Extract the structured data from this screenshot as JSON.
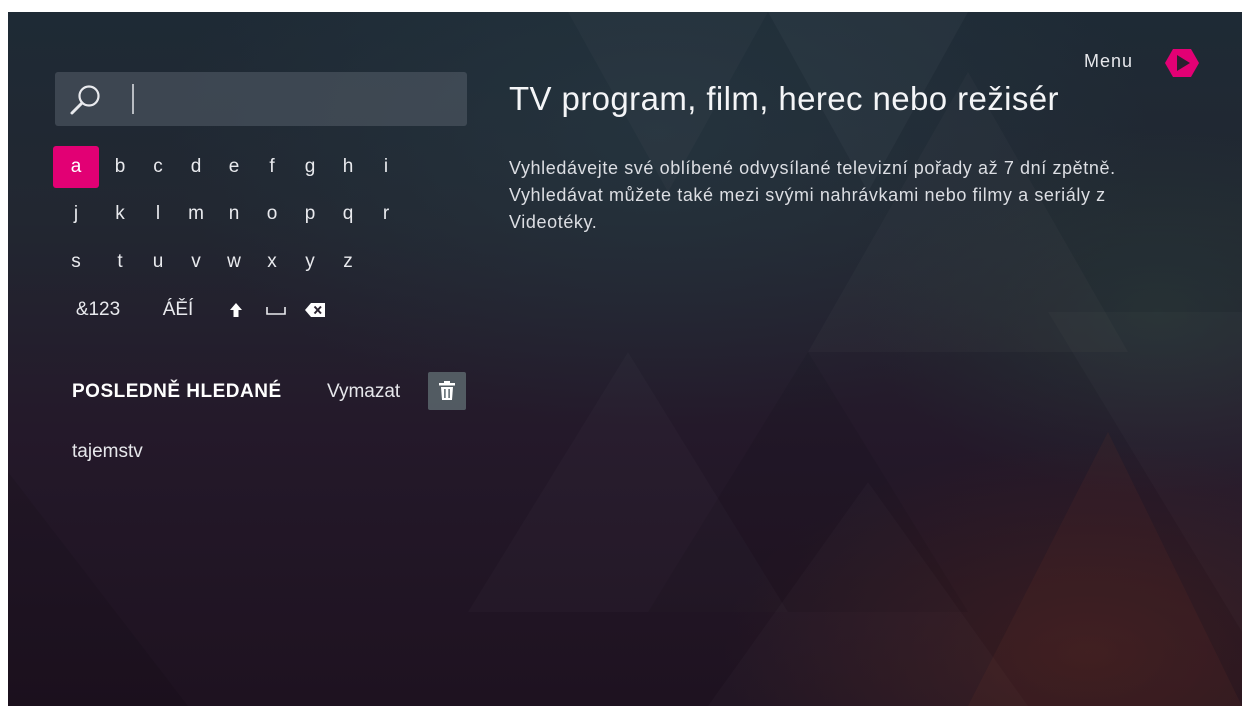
{
  "search": {
    "value": ""
  },
  "keyboard": {
    "rows": [
      [
        "a",
        "b",
        "c",
        "d",
        "e",
        "f",
        "g",
        "h",
        "i"
      ],
      [
        "j",
        "k",
        "l",
        "m",
        "n",
        "o",
        "p",
        "q",
        "r"
      ],
      [
        "s",
        "t",
        "u",
        "v",
        "w",
        "x",
        "y",
        "z"
      ]
    ],
    "special": {
      "numbers": "&123",
      "accents": "ÁĚÍ",
      "shift_icon": "up-arrow-icon",
      "space_icon": "space-icon",
      "backspace_icon": "backspace-icon"
    },
    "active_key": "a"
  },
  "history": {
    "title": "POSLEDNĚ HLEDANÉ",
    "clear_label": "Vymazat",
    "clear_icon": "trash-icon",
    "items": [
      "tajemstv"
    ]
  },
  "info": {
    "headline": "TV program, film, herec nebo režisér",
    "description": "Vyhledávejte své oblíbené odvysílané televizní pořady až 7 dní zpětně. Vyhledávat můžete také mezi svými nahrávkami nebo filmy a seriály z Videotéky."
  },
  "menu": {
    "label": "Menu",
    "icon": "play-arrow-icon"
  },
  "colors": {
    "accent": "#e20074",
    "text": "#e9eaee"
  }
}
